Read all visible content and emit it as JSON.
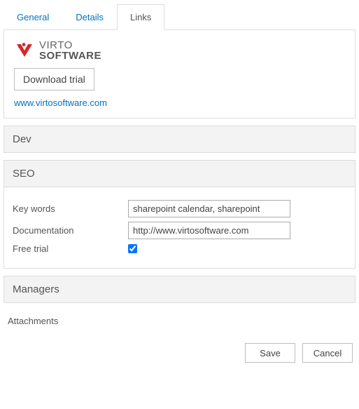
{
  "tabs": {
    "general": "General",
    "details": "Details",
    "links": "Links",
    "active": "links"
  },
  "top": {
    "logo_line1": "VIRTO",
    "logo_line2": "SOFTWARE",
    "download_label": "Download trial",
    "site_link": "www.virtosoftware.com"
  },
  "sections": {
    "dev": {
      "title": "Dev"
    },
    "seo": {
      "title": "SEO",
      "keywords_label": "Key words",
      "keywords_value": "sharepoint calendar, sharepoint",
      "doc_label": "Documentation",
      "doc_value": "http://www.virtosoftware.com",
      "freetrial_label": "Free trial",
      "freetrial_checked": true
    },
    "managers": {
      "title": "Managers"
    }
  },
  "attachments_label": "Attachments",
  "footer": {
    "save": "Save",
    "cancel": "Cancel"
  }
}
